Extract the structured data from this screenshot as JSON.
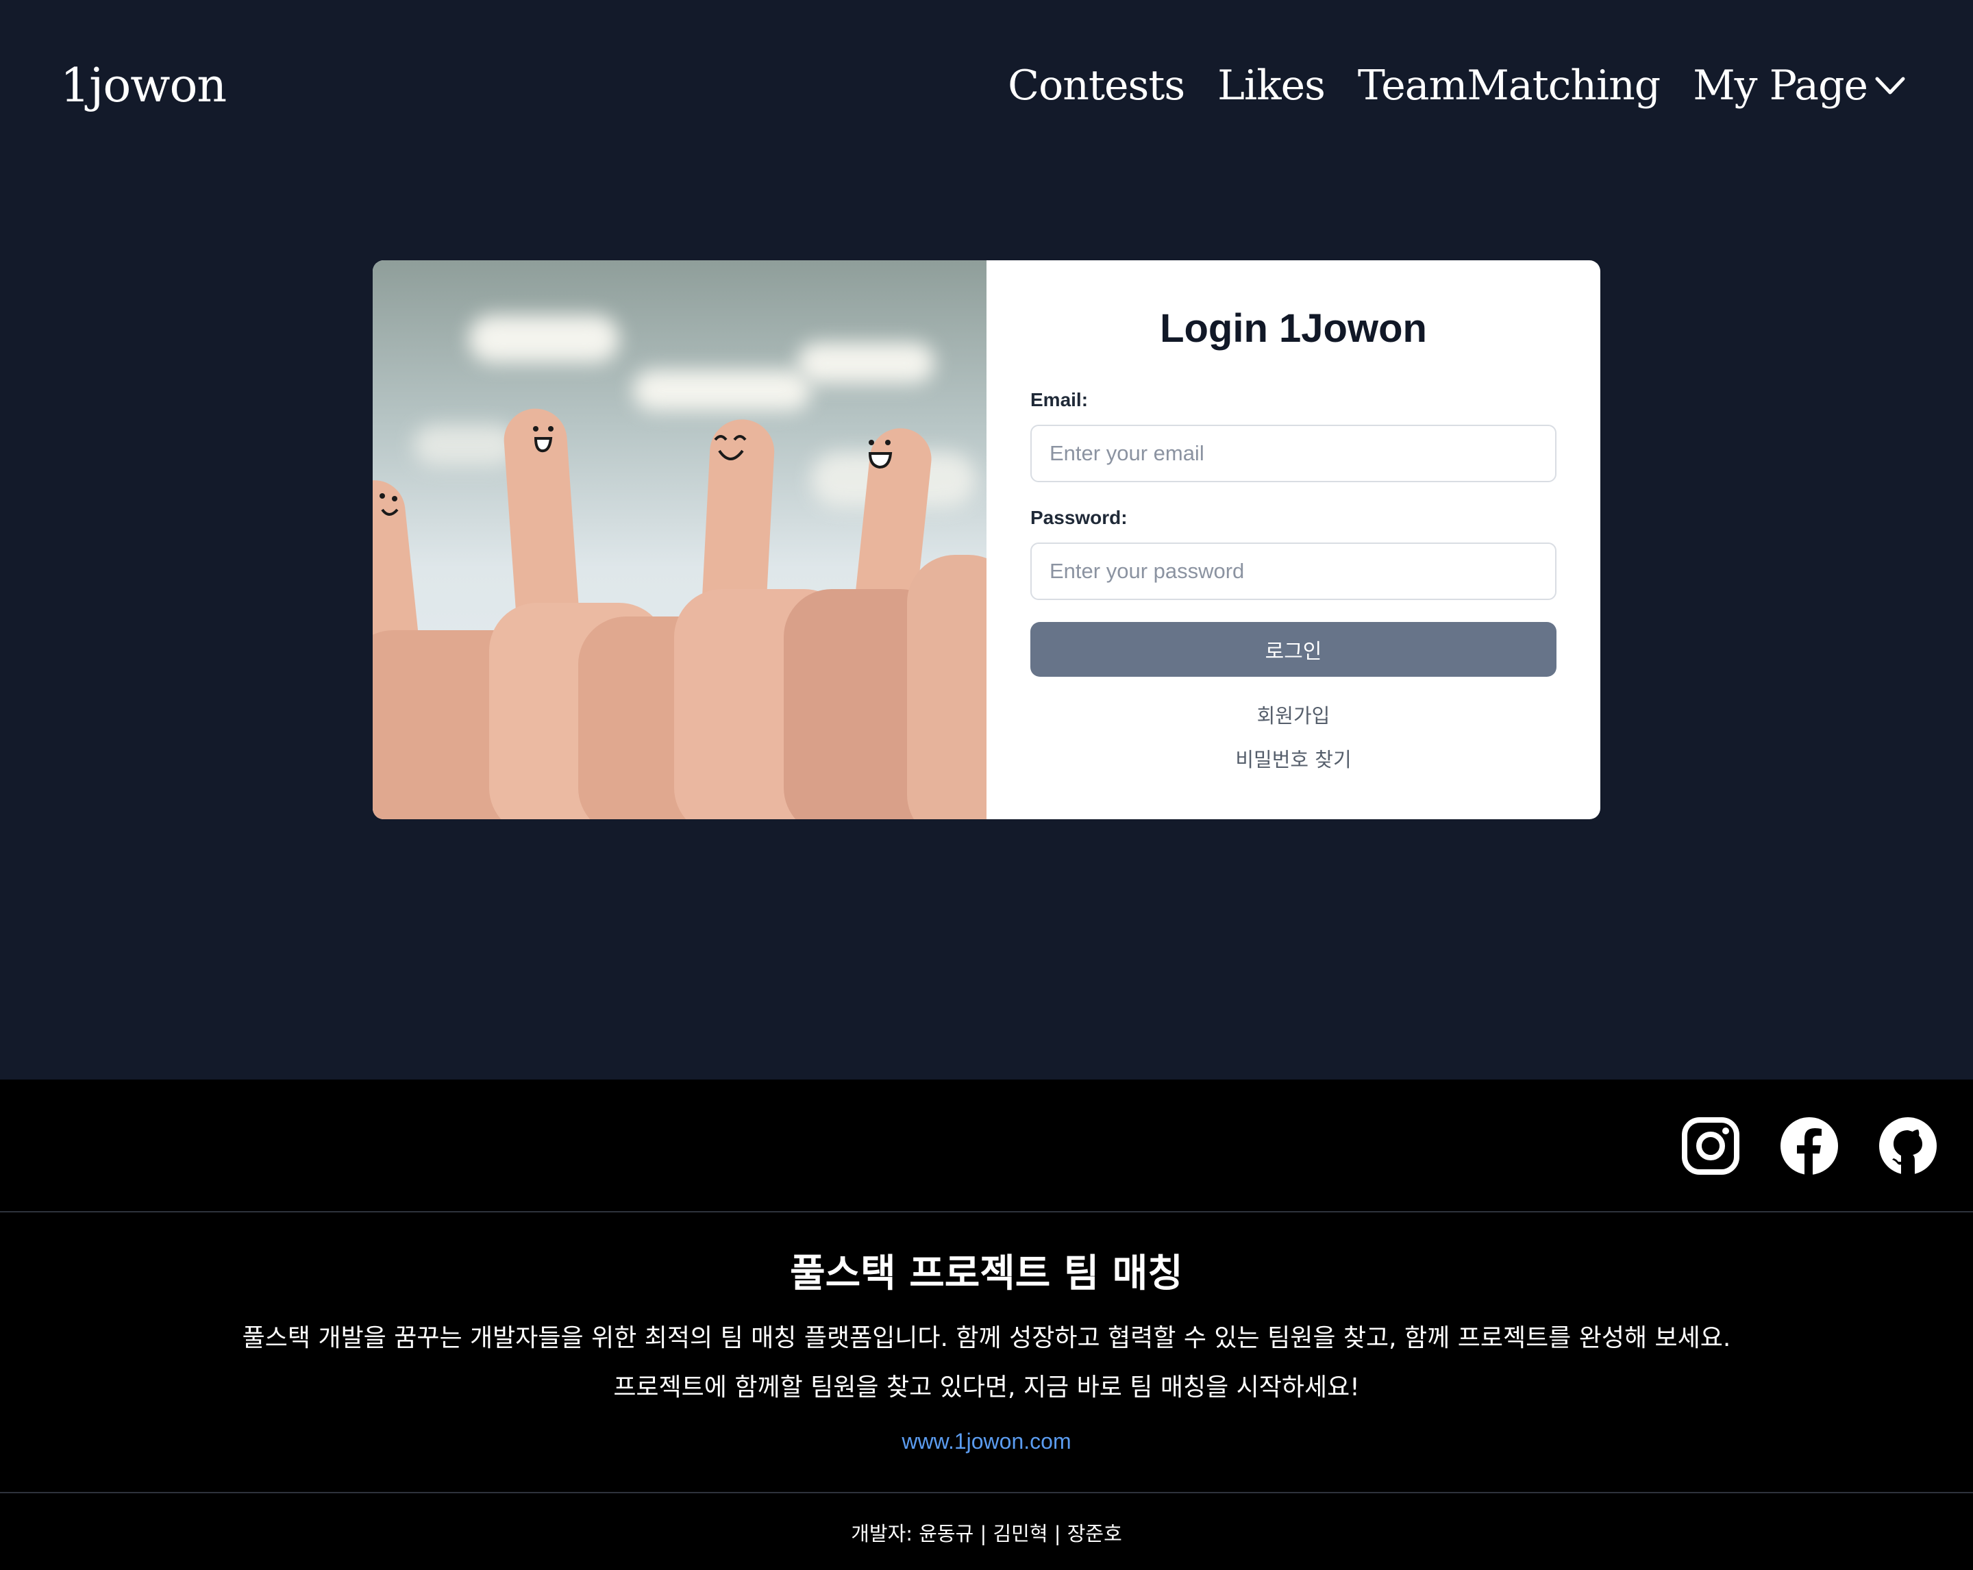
{
  "header": {
    "logo": "1jowon",
    "nav": {
      "contests": "Contests",
      "likes": "Likes",
      "team_matching": "TeamMatching",
      "my_page": "My Page"
    }
  },
  "login": {
    "title": "Login 1Jowon",
    "email_label": "Email:",
    "email_placeholder": "Enter your email",
    "email_value": "",
    "password_label": "Password:",
    "password_placeholder": "Enter your password",
    "password_value": "",
    "submit_label": "로그인",
    "signup_link": "회원가입",
    "find_password_link": "비밀번호 찾기"
  },
  "footer": {
    "social": [
      "instagram-icon",
      "facebook-icon",
      "github-icon"
    ],
    "title": "풀스택 프로젝트 팀 매칭",
    "description_1": "풀스택 개발을 꿈꾸는 개발자들을 위한 최적의 팀 매칭 플랫폼입니다. 함께 성장하고 협력할 수 있는 팀원을 찾고, 함께 프로젝트를 완성해 보세요.",
    "description_2": "프로젝트에 함께할 팀원을 찾고 있다면, 지금 바로 팀 매칭을 시작하세요!",
    "website": "www.1jowon.com",
    "credits": "개발자: 윤동규 | 김민혁 | 장준호"
  },
  "colors": {
    "page_background": "#131a2a",
    "footer_background": "#000000",
    "button": "#677489",
    "link": "#5b9cf0"
  }
}
